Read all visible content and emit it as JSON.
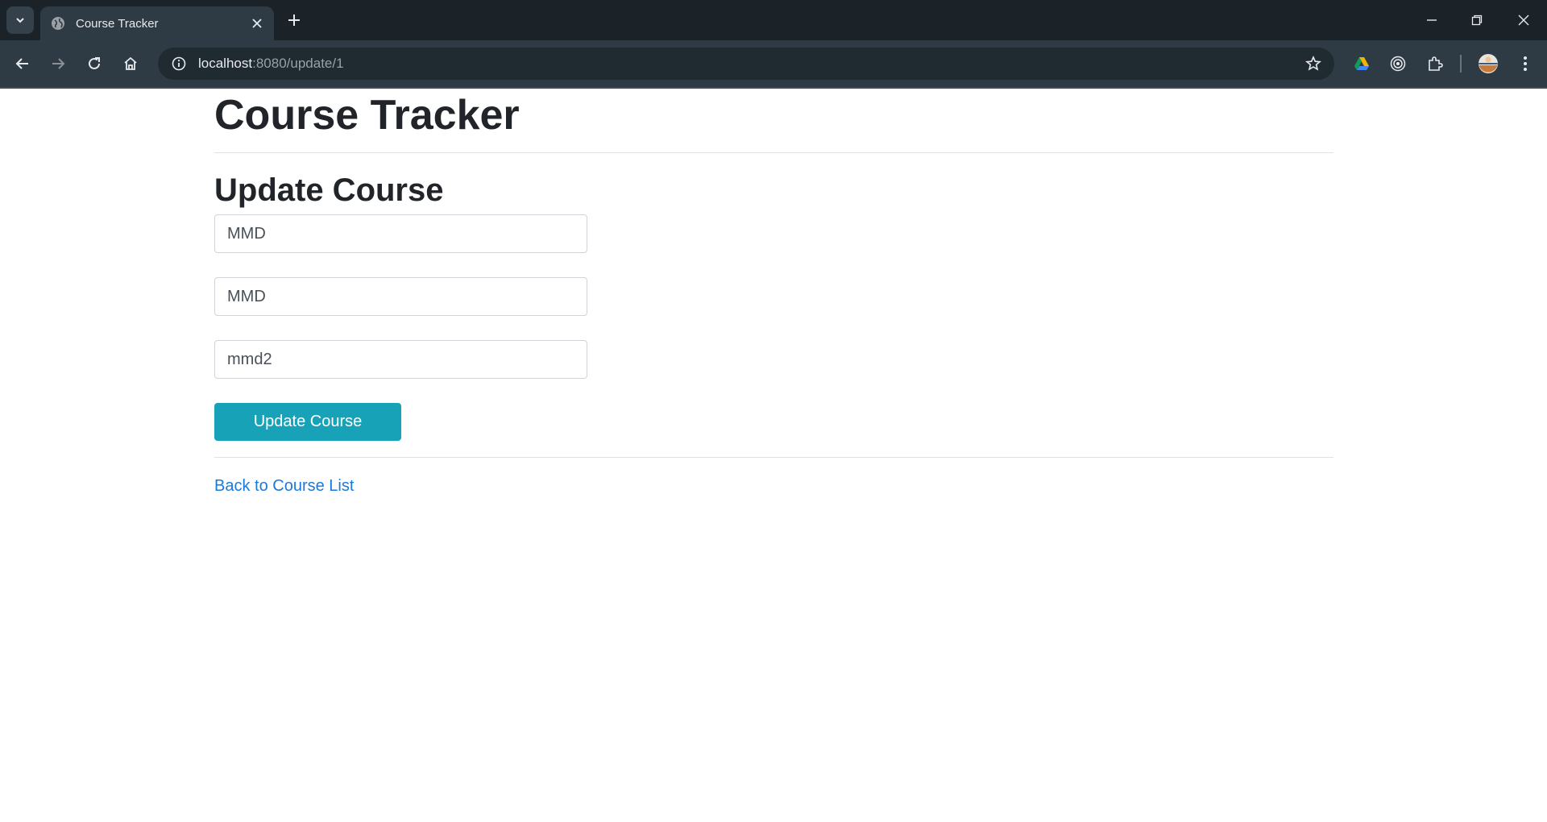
{
  "browser": {
    "tab": {
      "title": "Course Tracker"
    },
    "address": {
      "host": "localhost",
      "path": ":8080/update/1"
    }
  },
  "page": {
    "app_title": "Course Tracker",
    "section_title": "Update Course",
    "form": {
      "fields": [
        {
          "value": "MMD"
        },
        {
          "value": "MMD"
        },
        {
          "value": "mmd2"
        }
      ],
      "submit_label": "Update Course"
    },
    "back_link": "Back to Course List"
  },
  "colors": {
    "button": "#17a2b8",
    "link": "#1a7ad9",
    "titlebar": "#1b2329",
    "toolbar": "#2f3b44"
  }
}
